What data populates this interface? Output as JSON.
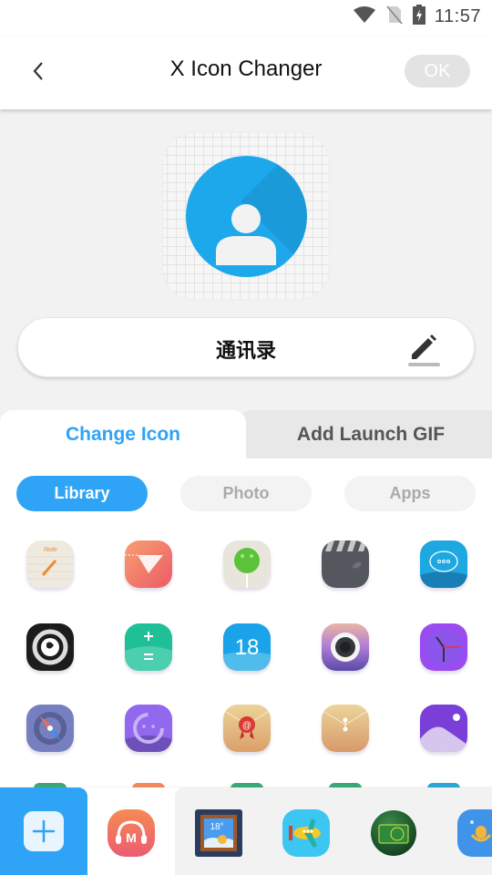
{
  "status_bar": {
    "time": "11:57",
    "icons": [
      "wifi-icon",
      "no-sim-icon",
      "battery-charging-icon"
    ]
  },
  "app_bar": {
    "back_icon": "chevron-left-icon",
    "title": "X Icon Changer",
    "ok_label": "OK",
    "ok_enabled": false
  },
  "preview": {
    "icon": "contacts-icon",
    "accent": "#1ea8ec"
  },
  "app_name": {
    "value": "通讯录",
    "edit_icon": "pencil-icon"
  },
  "tabs": [
    {
      "label": "Change Icon",
      "active": true
    },
    {
      "label": "Add Launch GIF",
      "active": false
    }
  ],
  "sources": [
    {
      "label": "Library",
      "active": true
    },
    {
      "label": "Photo",
      "active": false
    },
    {
      "label": "Apps",
      "active": false
    }
  ],
  "library_icons": [
    [
      "notes-icon",
      "paper-plane-icon",
      "lollipop-icon",
      "clapperboard-icon",
      "message-icon"
    ],
    [
      "browser-globe-icon",
      "calculator-icon",
      "calendar-icon",
      "camera-icon",
      "clock-icon"
    ],
    [
      "compass-icon",
      "chat-bubble-icon",
      "email-icon",
      "envelope-icon",
      "gallery-icon"
    ]
  ],
  "calendar_day": "18",
  "bottom_bar": {
    "add_icon": "plus-icon",
    "selected_icon": "music-headphones-icon",
    "tray_icons": [
      "weather-icon",
      "airplane-icon",
      "camera-green-icon",
      "voice-recorder-icon"
    ],
    "weather_temp": "18°",
    "music_letter": "M"
  },
  "colors": {
    "accent": "#2fa3f6",
    "tab_inactive_bg": "#e8e8e8",
    "segment_inactive_bg": "#f3f3f3"
  }
}
